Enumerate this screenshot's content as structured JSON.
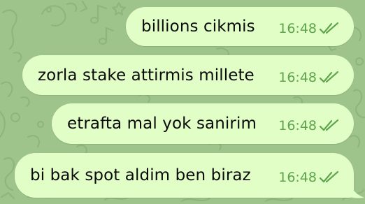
{
  "theme": {
    "wallpaper": "#9ec48b",
    "outgoing_bubble": "#e1fec7",
    "time_color": "#5ea44c",
    "text_color": "#0b0b0b"
  },
  "messages": [
    {
      "text": "billions cikmis",
      "time": "16:48",
      "status_icon": "double-check-read-icon"
    },
    {
      "text": "zorla stake attirmis millete",
      "time": "16:48",
      "status_icon": "double-check-read-icon"
    },
    {
      "text": "etrafta mal yok sanirim",
      "time": "16:48",
      "status_icon": "double-check-read-icon"
    },
    {
      "text": "bi bak spot aldim ben biraz",
      "time": "16:48",
      "status_icon": "double-check-read-icon"
    }
  ]
}
